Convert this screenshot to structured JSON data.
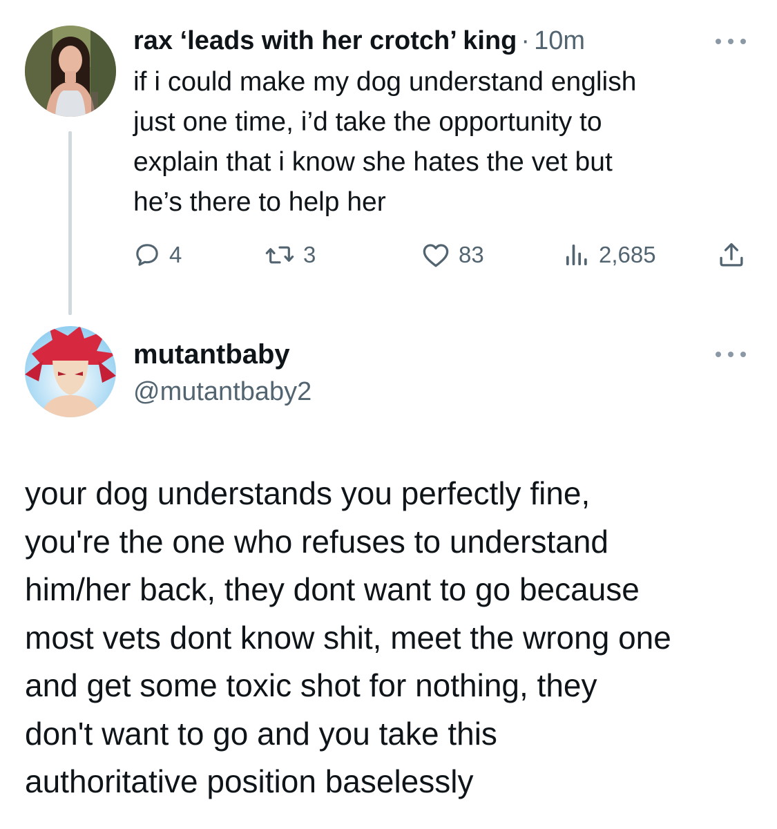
{
  "parent_tweet": {
    "display_name": "rax ‘leads with her crotch’ king",
    "separator": "·",
    "timestamp": "10m",
    "text": "if i could make my dog understand english\njust one time, i’d take the opportunity to\nexplain that i know she hates the vet but\nhe’s there to help her",
    "actions": {
      "replies": "4",
      "retweets": "3",
      "likes": "83",
      "views": "2,685"
    },
    "icons": {
      "reply": "reply-icon",
      "retweet": "retweet-icon",
      "like": "heart-icon",
      "views": "views-chart-icon",
      "share": "share-icon",
      "more": "more-icon"
    }
  },
  "reply_tweet": {
    "display_name": "mutantbaby",
    "handle": "@mutantbaby2",
    "text": "your dog understands you perfectly fine,\nyou're the one who refuses to understand\nhim/her back, they dont want to go because\nmost vets dont know shit, meet the wrong one\nand get some toxic shot for nothing, they\ndon't want to go and you take this\nauthoritative position baselessly"
  },
  "colors": {
    "text_primary": "#0f1419",
    "text_secondary": "#536471",
    "thread_line": "#cfd9de",
    "more_dots": "#8b98a5"
  }
}
